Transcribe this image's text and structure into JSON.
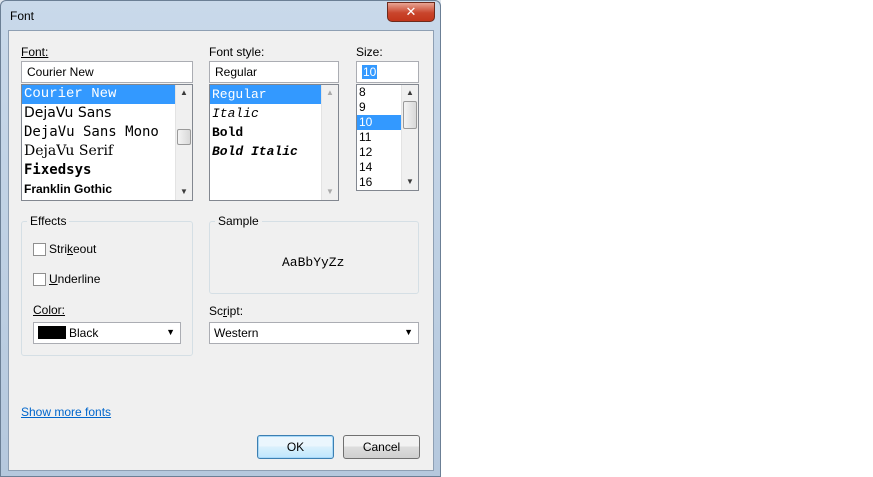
{
  "window": {
    "title": "Font",
    "close_glyph": "✕"
  },
  "font": {
    "label": "Font:",
    "value": "Courier New",
    "items": [
      {
        "label": "Courier New",
        "selected": true
      },
      {
        "label": "DejaVu Sans"
      },
      {
        "label": "DejaVu Sans Mono"
      },
      {
        "label": "DejaVu Serif"
      },
      {
        "label": "Fixedsys"
      },
      {
        "label": "Franklin Gothic"
      }
    ]
  },
  "style": {
    "label": "Font style:",
    "value": "Regular",
    "items": [
      {
        "label": "Regular",
        "selected": true
      },
      {
        "label": "Italic"
      },
      {
        "label": "Bold"
      },
      {
        "label": "Bold Italic"
      }
    ]
  },
  "size": {
    "label": "Size:",
    "value": "10",
    "items": [
      {
        "label": "8"
      },
      {
        "label": "9"
      },
      {
        "label": "10",
        "selected": true
      },
      {
        "label": "11"
      },
      {
        "label": "12"
      },
      {
        "label": "14"
      },
      {
        "label": "16"
      }
    ]
  },
  "effects": {
    "title": "Effects",
    "strikeout": {
      "label_pre": "Stri",
      "label_u": "k",
      "label_post": "eout",
      "checked": false
    },
    "underline": {
      "label_u": "U",
      "label_post": "nderline",
      "checked": false
    },
    "color_label": "Color:",
    "color_value": "Black",
    "color_hex": "#000000"
  },
  "sample": {
    "title": "Sample",
    "text": "AaBbYyZz"
  },
  "script": {
    "label_pre": "Sc",
    "label_u": "r",
    "label_post": "ipt:",
    "value": "Western"
  },
  "show_more_fonts": "Show more fonts",
  "buttons": {
    "ok": "OK",
    "cancel": "Cancel"
  },
  "icons": {
    "scroll_up": "▲",
    "scroll_down": "▼",
    "dropdown": "▼"
  }
}
